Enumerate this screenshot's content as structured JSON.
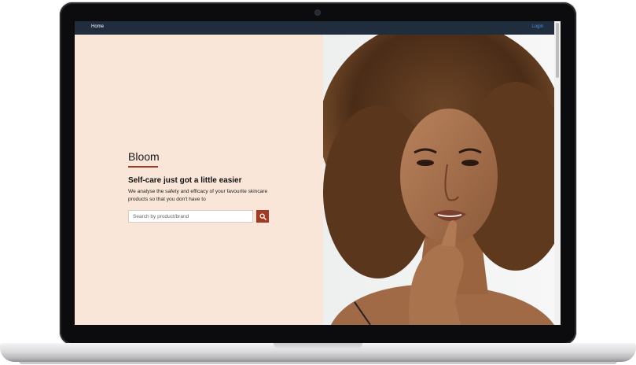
{
  "nav": {
    "home_label": "Home",
    "login_label": "Login"
  },
  "hero": {
    "brand": "Bloom",
    "tagline": "Self-care just got a little easier",
    "description": "We analyse the safety and efficacy of your favourite skincare products so that you don't have to"
  },
  "search": {
    "placeholder": "Search by product/brand",
    "value": "",
    "button_icon": "search-icon"
  },
  "colors": {
    "accent": "#a23a24",
    "navbar": "#1f2d3d",
    "hero_background": "#fae6d8",
    "login_link": "#4a90e2"
  },
  "image": {
    "subject": "portrait-photo"
  }
}
